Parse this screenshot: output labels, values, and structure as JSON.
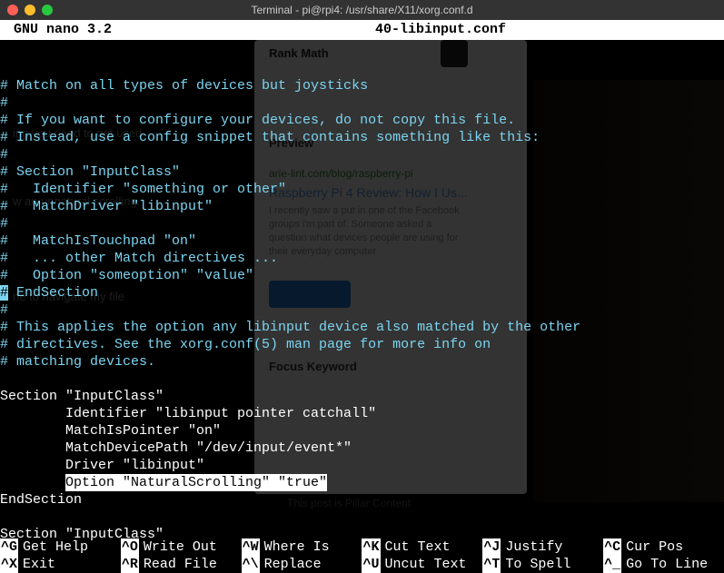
{
  "window": {
    "title": "Terminal - pi@rpi4: /usr/share/X11/xorg.conf.d"
  },
  "header": {
    "app": "GNU nano 3.2",
    "filename": "40-libinput.conf"
  },
  "lines": {
    "l0": "# Match on all types of devices but joysticks",
    "l1": "#",
    "l2": "# If you want to configure your devices, do not copy this file.",
    "l3": "# Instead, use a config snippet that contains something like this:",
    "l4": "#",
    "l5": "# Section \"InputClass\"",
    "l6": "#   Identifier \"something or other\"",
    "l7": "#   MatchDriver \"libinput\"",
    "l8": "#",
    "l9": "#   MatchIsTouchpad \"on\"",
    "l10": "#   ... other Match directives ...",
    "l11": "#   Option \"someoption\" \"value\"",
    "l12a": "#",
    "l12b": " EndSection",
    "l13": "#",
    "l14": "# This applies the option any libinput device also matched by the other",
    "l15": "# directives. See the xorg.conf(5) man page for more info on",
    "l16": "# matching devices.",
    "l17": "",
    "l18": "Section \"InputClass\"",
    "l19": "        Identifier \"libinput pointer catchall\"",
    "l20": "        MatchIsPointer \"on\"",
    "l21": "        MatchDevicePath \"/dev/input/event*\"",
    "l22": "        Driver \"libinput\"",
    "l23a": "        ",
    "l23b": "Option \"NaturalScrolling\" \"true\"",
    "l24": "EndSection",
    "l25": "",
    "l26": "Section \"InputClass\""
  },
  "footer": {
    "r1c1k": "^G",
    "r1c1l": "Get Help",
    "r1c2k": "^O",
    "r1c2l": "Write Out",
    "r1c3k": "^W",
    "r1c3l": "Where Is",
    "r1c4k": "^K",
    "r1c4l": "Cut Text",
    "r1c5k": "^J",
    "r1c5l": "Justify",
    "r1c6k": "^C",
    "r1c6l": "Cur Pos",
    "r2c1k": "^X",
    "r2c1l": "Exit",
    "r2c2k": "^R",
    "r2c2l": "Read File",
    "r2c3k": "^\\",
    "r2c3l": "Replace",
    "r2c4k": "^U",
    "r2c4l": "Uncut Text",
    "r2c5k": "^T",
    "r2c5l": "To Spell",
    "r2c6k": "^_",
    "r2c6l": "Go To Line"
  },
  "bg": {
    "rmtitle": "Rank Math",
    "preview": "Preview",
    "url": "arie-lint.com/blog/raspberry-pi",
    "hl": "Raspberry Pi 4 Review: How I Us...",
    "p1": "I recently saw a put in one of the Facebook",
    "p2": "groups i'm part of. Someone asked a",
    "p3": "question what devices people are using for",
    "p4": "their everyday computer",
    "fk": "Focus Keyword",
    "pillar": "This post is Pillar Content"
  }
}
